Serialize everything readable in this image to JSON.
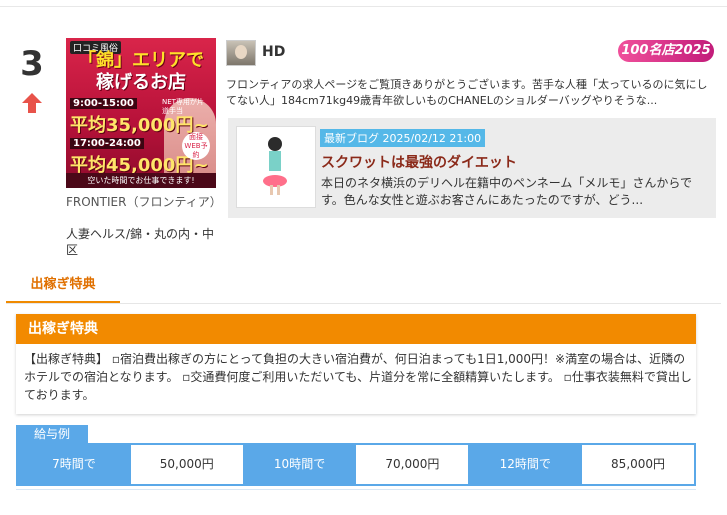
{
  "rank": {
    "number": "3",
    "trend_icon": "up-arrow-icon",
    "trend_color": "#e8534a"
  },
  "shop": {
    "banner": {
      "top_line": "口コミ風俗",
      "catch_line_1": "「錦」エリアで",
      "catch_line_2": "稼げるお店",
      "time_1": "9:00-15:00",
      "pay_1": "平均35,000円~",
      "time_2": "17:00-24:00",
      "pay_2": "平均45,000円~",
      "badge_text": "面接WEB予約",
      "note_text": "NET専用が片道手当",
      "bottom_text": "空いた時間でお仕事できます!"
    },
    "name": "FRONTIER（フロンティア）",
    "area": "人妻ヘルス/錦・丸の内・中区"
  },
  "review": {
    "reviewer_name": "HD",
    "award_badge": "100名店2025",
    "text": "フロンティアの求人ページをご覧頂きありがとうございます。苦手な人種「太っているのに気にしてない人」184cm71kg49歳青年欲しいものCHANELのショルダーバッグやりそうな..."
  },
  "blog": {
    "tag": "最新ブログ 2025/02/12 21:00",
    "title": "スクワットは最強のダイエット",
    "excerpt": "本日のネタ横浜のデリヘル在籍中のペンネーム「メルモ」さんからです。色んな女性と遊ぶお客さんにあたったのですが、どう..."
  },
  "tabs": {
    "active_label": "出稼ぎ特典"
  },
  "perk": {
    "heading": "出稼ぎ特典",
    "body": "【出稼ぎ特典】 ▫宿泊費出稼ぎの方にとって負担の大きい宿泊費が、何日泊まっても1日1,000円！※満室の場合は、近隣のホテルでの宿泊となります。 ▫交通費何度ご利用いただいても、片道分を常に全額精算いたします。 ▫仕事衣装無料で貸出しております。"
  },
  "salary": {
    "label": "給与例",
    "rows": [
      {
        "hours": "7時間で",
        "pay": "50,000円"
      },
      {
        "hours": "10時間で",
        "pay": "70,000円"
      },
      {
        "hours": "12時間で",
        "pay": "85,000円"
      }
    ]
  },
  "colors": {
    "accent_orange": "#f28a00",
    "salary_blue": "#5aa8e8",
    "blog_tag_blue": "#55b8e8"
  }
}
